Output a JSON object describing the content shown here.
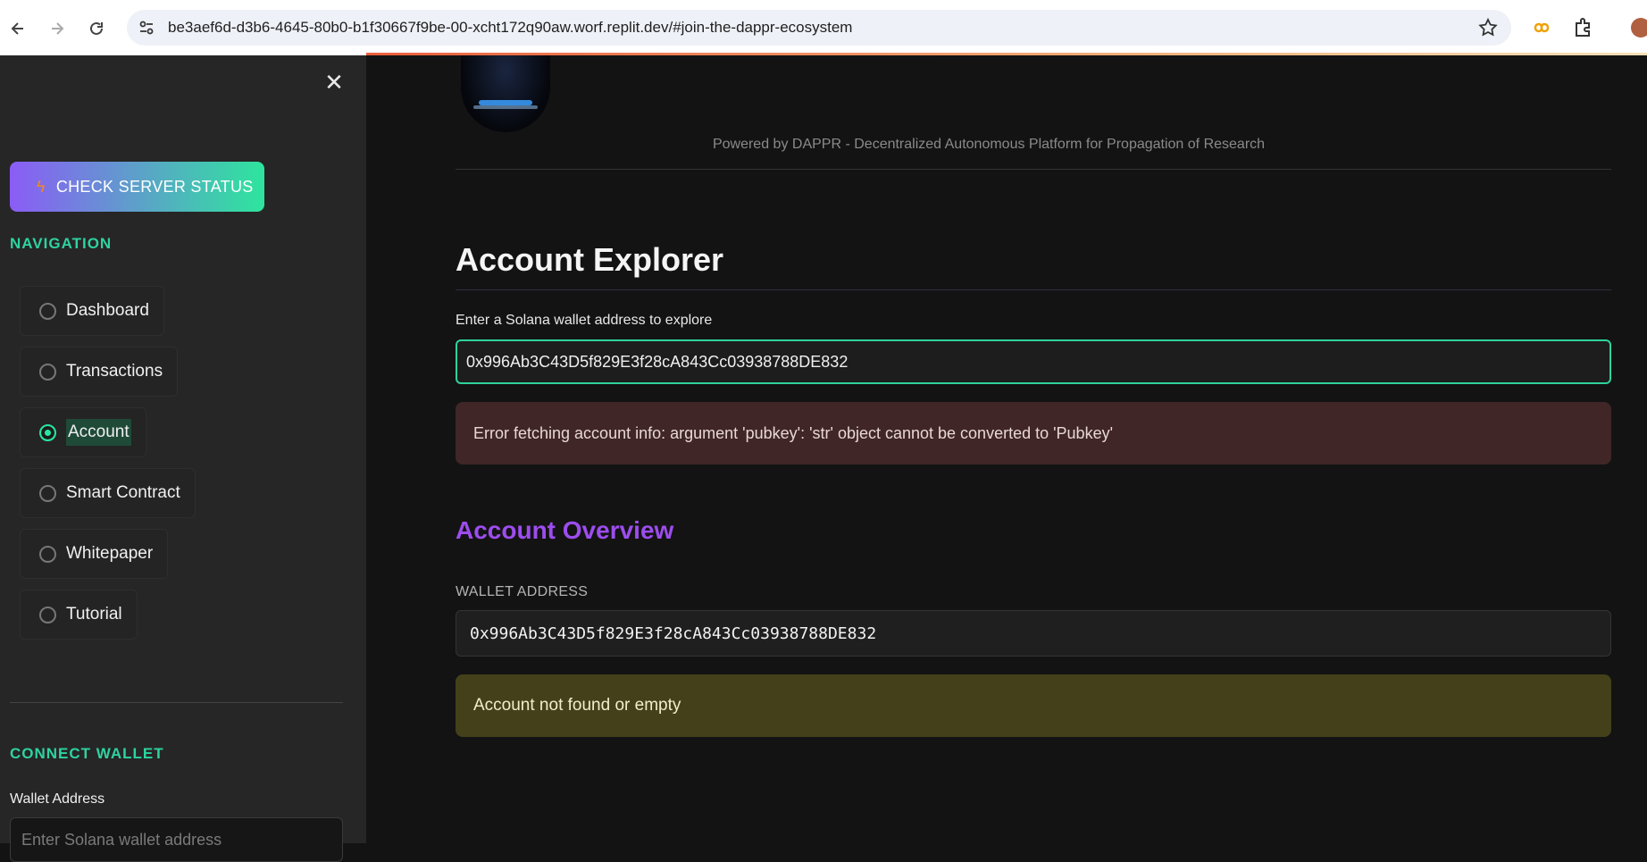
{
  "browser": {
    "url": "be3aef6d-d3b6-4645-80b0-b1f30667f9be-00-xcht172q90aw.worf.replit.dev/#join-the-dappr-ecosystem",
    "back_icon": "arrow-left-icon",
    "forward_icon": "arrow-right-icon",
    "reload_icon": "reload-icon",
    "site_info_icon": "tune-icon",
    "bookmark_icon": "star-icon",
    "extension_icons": [
      "infinity-extension-icon",
      "puzzle-extension-icon",
      "profile-avatar-icon"
    ]
  },
  "sidebar": {
    "close_icon": "close-icon",
    "status_button": {
      "icon": "bolt-icon",
      "label": "CHECK SERVER STATUS"
    },
    "navigation_heading": "NAVIGATION",
    "nav_items": [
      {
        "label": "Dashboard",
        "selected": false
      },
      {
        "label": "Transactions",
        "selected": false
      },
      {
        "label": "Account",
        "selected": true
      },
      {
        "label": "Smart Contract",
        "selected": false
      },
      {
        "label": "Whitepaper",
        "selected": false
      },
      {
        "label": "Tutorial",
        "selected": false
      }
    ],
    "connect_heading": "CONNECT WALLET",
    "wallet_label": "Wallet Address",
    "wallet_placeholder": "Enter Solana wallet address"
  },
  "main": {
    "powered_by": "Powered by DAPPR - Decentralized Autonomous Platform for Propagation of Research",
    "title": "Account Explorer",
    "input_label": "Enter a Solana wallet address to explore",
    "input_value": "0x996Ab3C43D5f829E3f28cA843Cc03938788DE832",
    "error_message": "Error fetching account info: argument 'pubkey': 'str' object cannot be converted to 'Pubkey'",
    "overview_title": "Account Overview",
    "wallet_address_label": "WALLET ADDRESS",
    "wallet_address_value": "0x996Ab3C43D5f829E3f28cA843Cc03938788DE832",
    "warning_message": "Account not found or empty"
  },
  "colors": {
    "accent_green": "#2ed3a0",
    "accent_purple": "#9d4dee",
    "error_bg": "#402626",
    "warning_bg": "#44401a"
  }
}
